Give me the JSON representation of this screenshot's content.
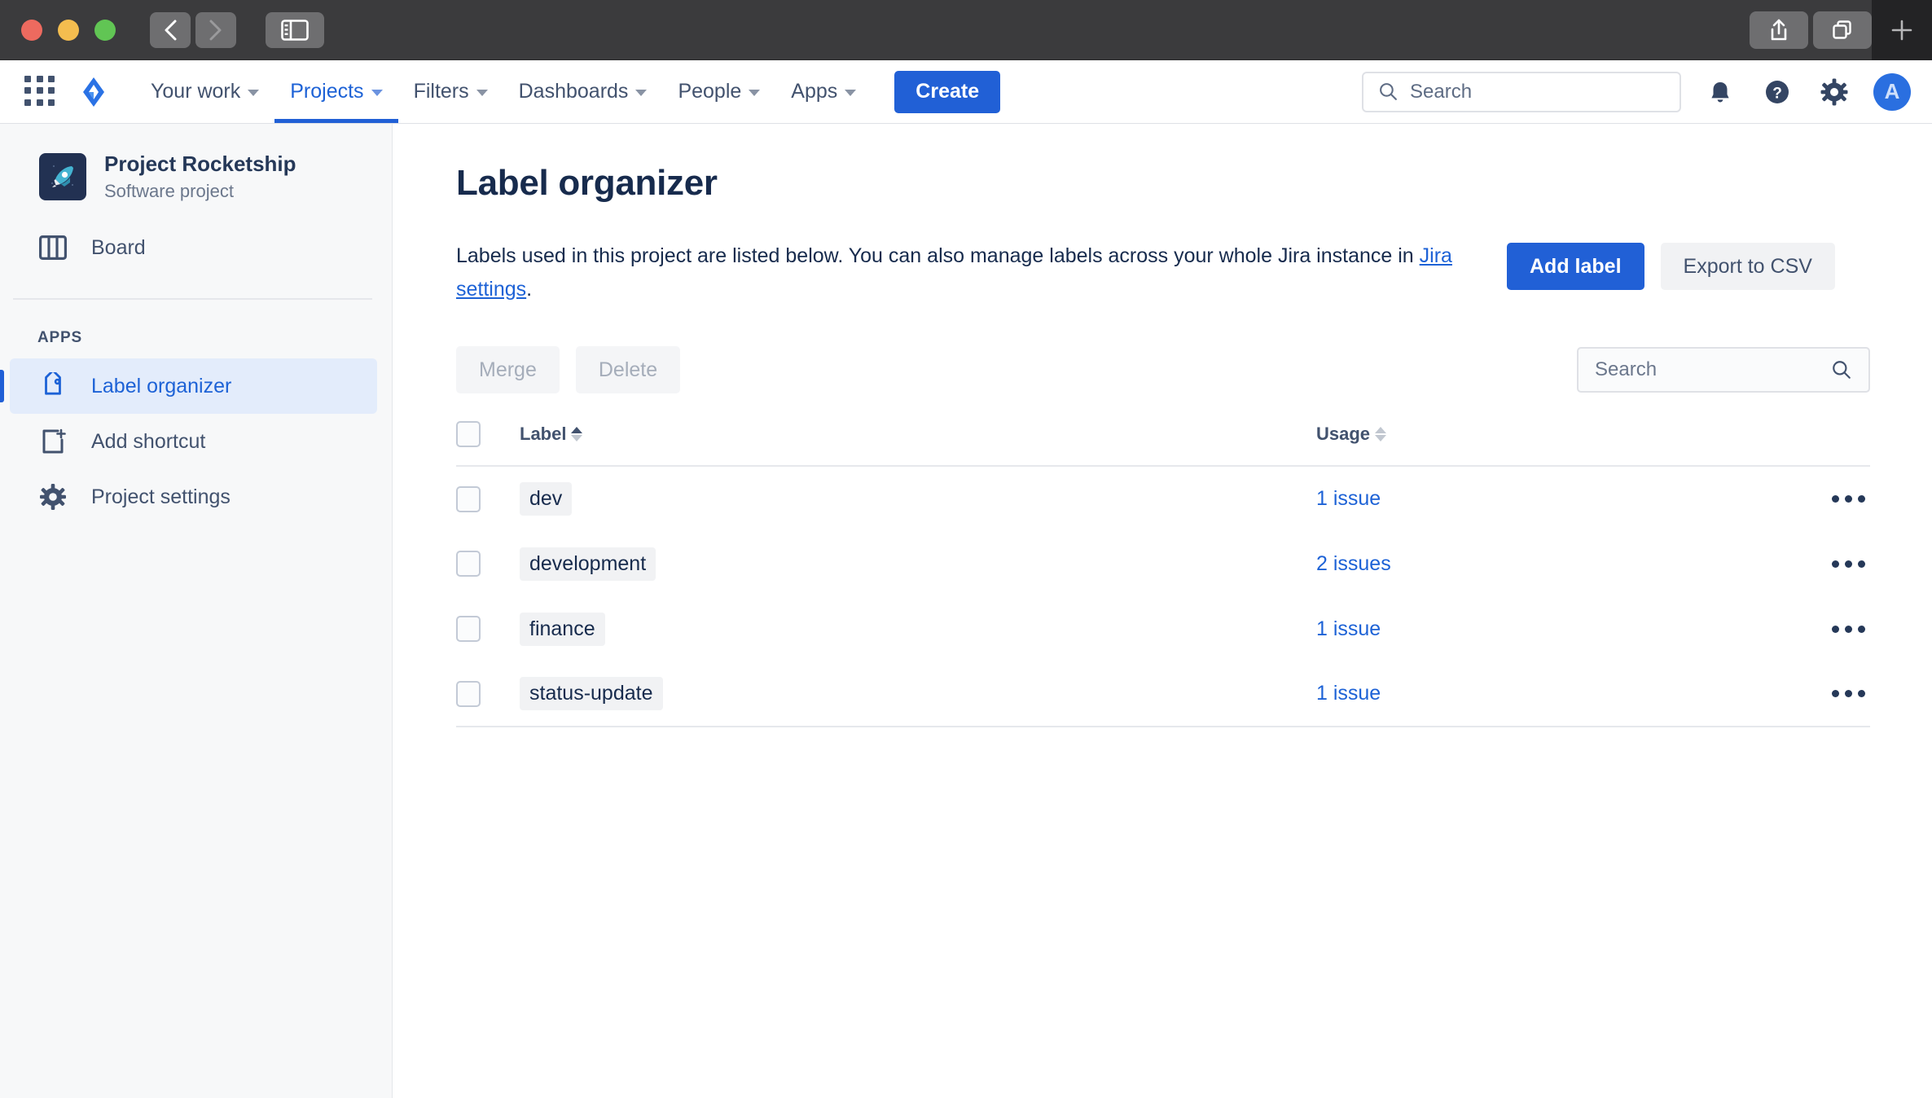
{
  "window": {
    "traffic_lights": [
      "close",
      "minimize",
      "maximize"
    ],
    "back_label": "Back",
    "forward_label": "Forward",
    "sidebar_toggle_label": "Toggle Sidebar",
    "share_label": "Share",
    "tab_overview_label": "Tab Overview",
    "new_tab_label": "New Tab"
  },
  "topnav": {
    "app_switcher_label": "App switcher",
    "logo_label": "Jira",
    "items": [
      {
        "label": "Your work",
        "active": false
      },
      {
        "label": "Projects",
        "active": true
      },
      {
        "label": "Filters",
        "active": false
      },
      {
        "label": "Dashboards",
        "active": false
      },
      {
        "label": "People",
        "active": false
      },
      {
        "label": "Apps",
        "active": false
      }
    ],
    "create_label": "Create",
    "search_placeholder": "Search",
    "notifications_label": "Notifications",
    "help_label": "Help",
    "settings_label": "Settings",
    "avatar_initial": "A"
  },
  "sidebar": {
    "project_name": "Project Rocketship",
    "project_type": "Software project",
    "project_avatar_icon": "rocket-icon",
    "board_label": "Board",
    "section_apps": "APPS",
    "apps": [
      {
        "label": "Label organizer",
        "icon": "tag-icon",
        "selected": true
      },
      {
        "label": "Add shortcut",
        "icon": "add-shortcut-icon",
        "selected": false
      },
      {
        "label": "Project settings",
        "icon": "gear-icon",
        "selected": false
      }
    ]
  },
  "main": {
    "title": "Label organizer",
    "description_before": "Labels used in this project are listed below. You can also manage labels across your whole Jira instance in ",
    "description_link": "Jira settings",
    "description_after": ".",
    "add_label_button": "Add label",
    "export_button": "Export to CSV",
    "merge_button": "Merge",
    "delete_button": "Delete",
    "table_search_placeholder": "Search",
    "columns": {
      "label": "Label",
      "usage": "Usage",
      "label_sort": "asc",
      "usage_sort": "none"
    },
    "rows": [
      {
        "label": "dev",
        "usage": "1 issue"
      },
      {
        "label": "development",
        "usage": "2 issues"
      },
      {
        "label": "finance",
        "usage": "1 issue"
      },
      {
        "label": "status-update",
        "usage": "1 issue"
      }
    ]
  },
  "colors": {
    "brand_blue": "#2160d6",
    "link_blue": "#1d62d6",
    "text_dark": "#172b4d",
    "text_muted": "#6b778c",
    "selected_bg": "#e3ecfb"
  }
}
